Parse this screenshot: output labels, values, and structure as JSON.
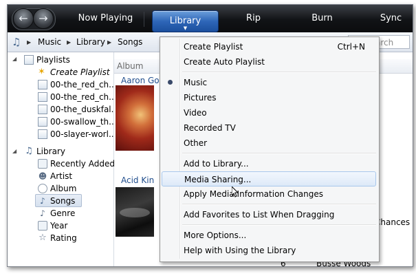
{
  "toolbar": {
    "back_icon": "back-arrow-icon",
    "forward_icon": "forward-arrow-icon",
    "tabs": [
      "Now Playing",
      "Library",
      "Rip",
      "Burn",
      "Sync"
    ],
    "active_tab": "Library"
  },
  "breadcrumb": {
    "items": [
      "Music",
      "Library",
      "Songs"
    ],
    "search_placeholder": "Search"
  },
  "nav": {
    "playlists_label": "Playlists",
    "create_playlist": "Create Playlist",
    "playlists": [
      "00-the_red_ch...",
      "00-the_red_ch...",
      "00-the_duskfal...",
      "00-swallow_th...",
      "00-slayer-worl..."
    ],
    "library_label": "Library",
    "library_items": [
      "Recently Added",
      "Artist",
      "Album",
      "Songs",
      "Genre",
      "Year",
      "Rating"
    ],
    "selected_item": "Songs"
  },
  "content": {
    "column_album": "Album",
    "artist1": "Aaron Go",
    "artist2": "Acid Kin",
    "partial_title": "Chances",
    "track_number": "6",
    "track_title": "Busse Woods"
  },
  "menu": {
    "items": [
      {
        "label": "Create Playlist",
        "shortcut": "Ctrl+N"
      },
      {
        "label": "Create Auto Playlist"
      },
      {
        "label": "Music",
        "checked": true
      },
      {
        "label": "Pictures"
      },
      {
        "label": "Video"
      },
      {
        "label": "Recorded TV"
      },
      {
        "label": "Other"
      },
      {
        "label": "Add to Library..."
      },
      {
        "label": "Media Sharing...",
        "highlighted": true
      },
      {
        "label": "Apply Media Information Changes"
      },
      {
        "label": "Add Favorites to List When Dragging"
      },
      {
        "label": "More Options..."
      },
      {
        "label": "Help with Using the Library"
      }
    ]
  }
}
